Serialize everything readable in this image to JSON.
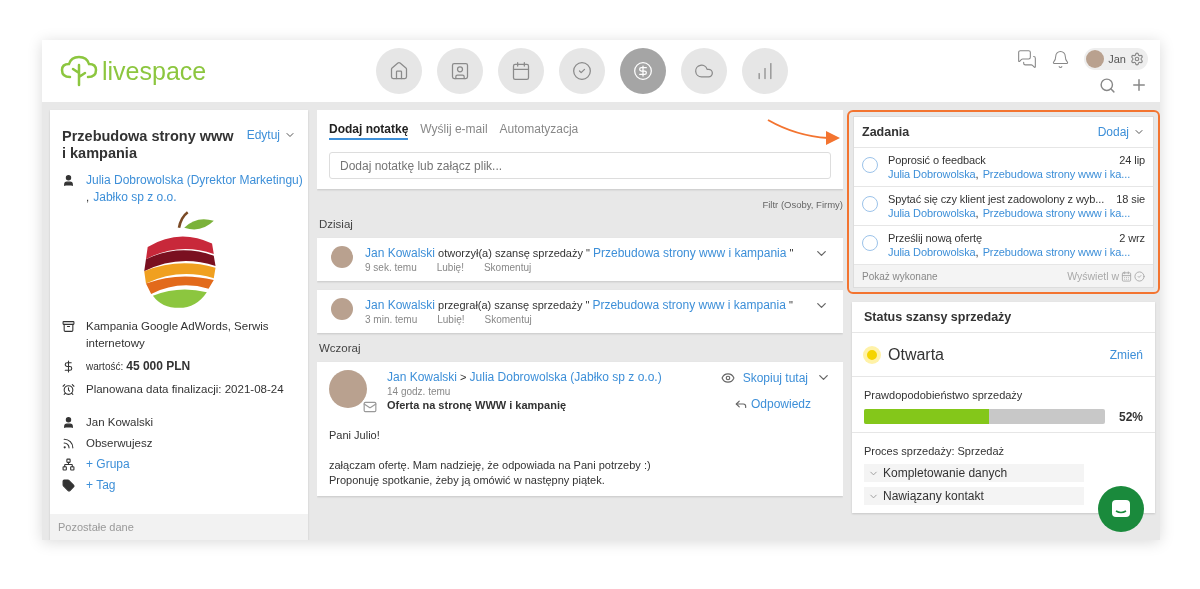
{
  "header": {
    "logo": "livespace",
    "nav": [
      {
        "kind": "home",
        "selected": false
      },
      {
        "kind": "contacts",
        "selected": false
      },
      {
        "kind": "calendar",
        "selected": false
      },
      {
        "kind": "tasks",
        "selected": false
      },
      {
        "kind": "deals",
        "selected": true
      },
      {
        "kind": "cloud",
        "selected": false
      },
      {
        "kind": "reports",
        "selected": false
      }
    ],
    "user": "Jan"
  },
  "deal": {
    "title": "Przebudowa strony www i kampania",
    "edit": "Edytuj",
    "contact": "Julia Dobrowolska (Dyrektor Marketingu)",
    "separator": ",",
    "company": "Jabłko sp z o.o.",
    "details": [
      {
        "kind": "products",
        "text": "Kampania Google AdWords, Serwis internetowy"
      },
      {
        "kind": "value",
        "label": "wartość:",
        "text": "45 000 PLN"
      },
      {
        "kind": "date",
        "text": "Planowana data finalizacji: 2021-08-24"
      },
      {
        "kind": "owner",
        "text": "Jan Kowalski"
      },
      {
        "kind": "follow",
        "text": "Obserwujesz"
      },
      {
        "kind": "group",
        "text": "+ Grupa"
      },
      {
        "kind": "tag",
        "text": "+ Tag"
      }
    ],
    "footer": "Pozostałe dane"
  },
  "composer": {
    "tabs": [
      {
        "label": "Dodaj notatkę",
        "selected": true
      },
      {
        "label": "Wyślij e-mail",
        "selected": false
      },
      {
        "label": "Automatyzacja",
        "selected": false
      }
    ],
    "placeholder": "Dodaj notatkę lub załącz plik...",
    "filter": "Filtr (Osoby, Firmy)"
  },
  "feed": [
    {
      "label": "Dzisiaj",
      "items": [
        {
          "kind": "activity",
          "author": "Jan Kowalski",
          "action": "otworzył(a) szansę sprzedaży \"",
          "deal": "Przebudowa strony www i kampania",
          "close": "\"",
          "time": "9 sek. temu",
          "like": "Lubię!",
          "comment": "Skomentuj"
        },
        {
          "kind": "activity",
          "author": "Jan Kowalski",
          "action": "przegrał(a) szansę sprzedaży \"",
          "deal": "Przebudowa strony www i kampania",
          "close": "\"",
          "time": "3 min. temu",
          "like": "Lubię!",
          "comment": "Skomentuj"
        }
      ]
    },
    {
      "label": "Wczoraj",
      "items": [
        {
          "kind": "email",
          "author": "Jan Kowalski",
          "arrow": ">",
          "recipient": "Julia Dobrowolska (Jabłko sp z o.o.)",
          "time": "14 godz. temu",
          "subject": "Oferta na stronę WWW i kampanię",
          "copy": "Skopiuj tutaj",
          "reply": "Odpowiedz",
          "body": [
            "Pani Julio!",
            "załączam ofertę. Mam nadzieję, że odpowiada na Pani potrzeby :)",
            "Proponuję spotkanie, żeby ją omówić w następny piątek."
          ]
        }
      ]
    }
  ],
  "tasks": {
    "title": "Zadania",
    "add": "Dodaj",
    "items": [
      {
        "title": "Poprosić o feedback",
        "date": "24 lip",
        "contact": "Julia Dobrowolska",
        "separator": ",",
        "deal": "Przebudowa strony www i ka...",
        "done": false
      },
      {
        "title": "Spytać się czy klient jest zadowolony z wyb...",
        "date": "18 sie",
        "contact": "Julia Dobrowolska",
        "separator": ",",
        "deal": "Przebudowa strony www i ka...",
        "done": false
      },
      {
        "title": "Prześlij nową ofertę",
        "date": "2 wrz",
        "contact": "Julia Dobrowolska",
        "separator": ",",
        "deal": "Przebudowa strony www i ka...",
        "done": false
      }
    ],
    "show_done": "Pokaż wykonane",
    "view_in": "Wyświetl w"
  },
  "status": {
    "title": "Status szansy sprzedaży",
    "state": "Otwarta",
    "color": "#f5d400",
    "change": "Zmień",
    "probability": {
      "label": "Prawdopodobieństwo sprzedaży",
      "level": 0.52,
      "reading": "52%"
    },
    "process": "Proces sprzedaży: Sprzedaż",
    "stages": [
      "Kompletowanie danych",
      "Nawiązany kontakt"
    ]
  }
}
